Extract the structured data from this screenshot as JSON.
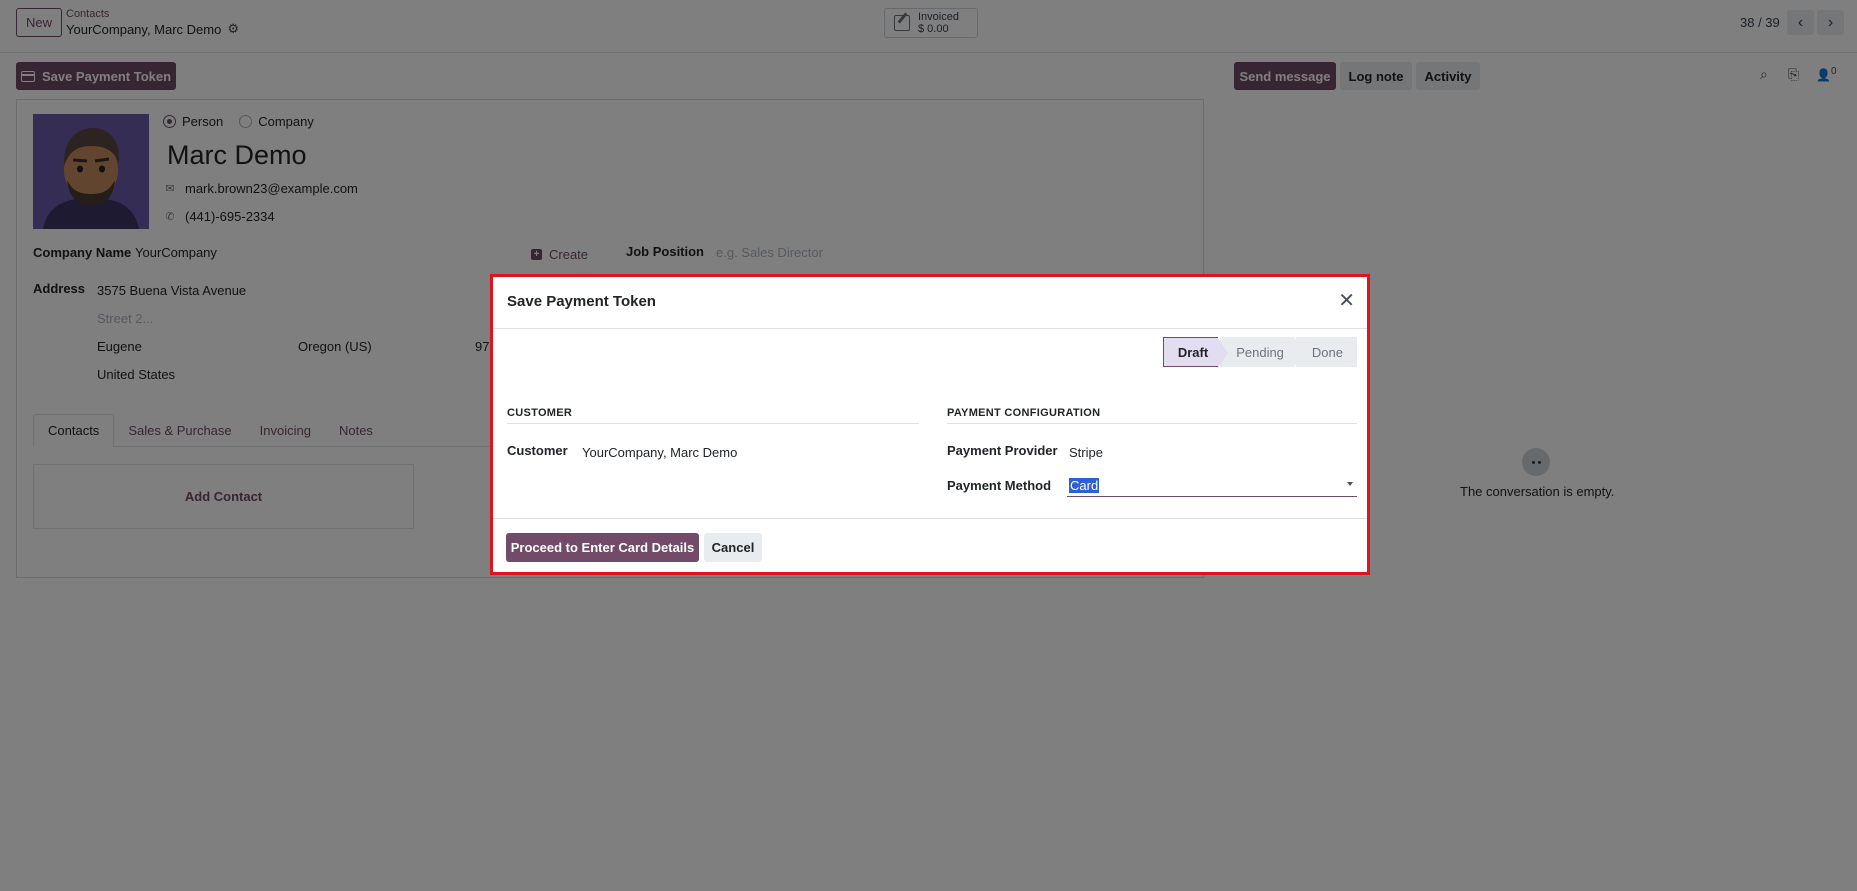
{
  "topbar": {
    "new_label": "New",
    "breadcrumb_parent": "Contacts",
    "breadcrumb_current": "YourCompany, Marc Demo",
    "invoiced_label": "Invoiced",
    "invoiced_amount": "$ 0.00",
    "pager": "38 / 39"
  },
  "form": {
    "action_button": "Save Payment Token",
    "company_type_options": [
      "Person",
      "Company"
    ],
    "company_type_selected": "Person",
    "name": "Marc Demo",
    "email": "mark.brown23@example.com",
    "phone": "(441)-695-2334",
    "company_name_label": "Company Name",
    "company_name_value": "YourCompany",
    "create_label": "Create",
    "job_position_label": "Job Position",
    "job_position_placeholder": "e.g. Sales Director",
    "address_label": "Address",
    "street": "3575  Buena Vista Avenue",
    "street2_placeholder": "Street 2...",
    "city": "Eugene",
    "state": "Oregon (US)",
    "zip_partial": "97",
    "country": "United States",
    "tabs": [
      "Contacts",
      "Sales & Purchase",
      "Invoicing",
      "Notes"
    ],
    "add_contact": "Add Contact"
  },
  "chatter": {
    "send_message": "Send message",
    "log_note": "Log note",
    "activity": "Activity",
    "followers_count": "0",
    "empty_text": "The conversation is empty."
  },
  "dialog": {
    "title": "Save Payment Token",
    "stages": [
      "Draft",
      "Pending",
      "Done"
    ],
    "active_stage": "Draft",
    "customer_section": "CUSTOMER",
    "customer_label": "Customer",
    "customer_value": "YourCompany, Marc Demo",
    "payment_section": "PAYMENT CONFIGURATION",
    "provider_label": "Payment Provider",
    "provider_value": "Stripe",
    "method_label": "Payment Method",
    "method_value": "Card",
    "proceed_button": "Proceed to Enter Card Details",
    "cancel_button": "Cancel"
  },
  "colors": {
    "brand": "#714b67",
    "highlight_border": "#e0141c",
    "selection": "#2d5fd6"
  }
}
